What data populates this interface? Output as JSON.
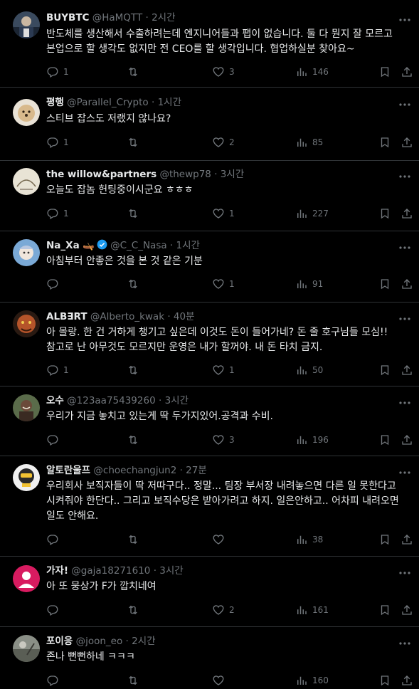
{
  "tweets": [
    {
      "name": "BUYBTC",
      "handle": "@HaMQTT",
      "time": "2시간",
      "text": "반도체를 생산해서 수출하려는데 엔지니어들과 팹이 없습니다. 둘 다 뭔지 잘 모르고 본업으로 할 생각도 없지만 전 CEO를 할 생각입니다. 협업하실분 찾아요~",
      "replies": "1",
      "retweets": "",
      "likes": "3",
      "views": "146"
    },
    {
      "name": "평행",
      "handle": "@Parallel_Crypto",
      "time": "1시간",
      "text": "스티브 잡스도 저랬지 않나요?",
      "replies": "1",
      "retweets": "",
      "likes": "2",
      "views": "85"
    },
    {
      "name": "the willow&partners",
      "handle": "@thewp78",
      "time": "3시간",
      "text": "오늘도 잡놈 헌팅중이시군요 ㅎㅎㅎ",
      "replies": "1",
      "retweets": "",
      "likes": "1",
      "views": "227"
    },
    {
      "name": "Na_Xa",
      "handle": "@C_C_Nasa",
      "time": "1시간",
      "text": "아침부터 안좋은 것을 본 것 같은 기분",
      "replies": "",
      "retweets": "",
      "likes": "1",
      "views": "91"
    },
    {
      "name": "ALB∃RT",
      "handle": "@Alberto_kwak",
      "time": "40분",
      "text": "아 몰랑. 한 건 거하게 챙기고 싶은데 이것도 돈이 들어가네? 돈 줄 호구님들 모심!! 참고로 난 아무것도 모르지만 운영은 내가 할꺼야. 내 돈 타치 금지.",
      "replies": "1",
      "retweets": "",
      "likes": "1",
      "views": "50"
    },
    {
      "name": "오수",
      "handle": "@123aa75439260",
      "time": "3시간",
      "text": "우리가 지금 놓치고 있는게 딱 두가지있어.공격과 수비.",
      "replies": "",
      "retweets": "",
      "likes": "3",
      "views": "196"
    },
    {
      "name": "알토란울프",
      "handle": "@choechangjun2",
      "time": "27분",
      "text": "우리회사 보직자들이 딱 저따구다.. 정말... 팀장 부서장 내려놓으면 다른 일 못한다고 시켜줘야 한단다.. 그리고 보직수당은 받아가려고 하지. 일은안하고.. 어차피 내려오면 일도 안해요.",
      "replies": "",
      "retweets": "",
      "likes": "",
      "views": "38"
    },
    {
      "name": "가자!",
      "handle": "@gaja18271610",
      "time": "3시간",
      "text": "아 또 뭉상가 F가 깝치네여",
      "replies": "",
      "retweets": "",
      "likes": "2",
      "views": "161"
    },
    {
      "name": "포이응",
      "handle": "@joon_eo",
      "time": "2시간",
      "text": "존나 뻔뻔하네 ㅋㅋㅋ",
      "replies": "",
      "retweets": "",
      "likes": "",
      "views": "160"
    }
  ],
  "icons": {
    "reply": "reply-icon",
    "retweet": "retweet-icon",
    "like": "heart-icon",
    "views": "views-icon",
    "bookmark": "bookmark-icon",
    "share": "share-icon",
    "more": "more-icon",
    "verified": "verified-badge-icon"
  },
  "colors": {
    "background": "#000000",
    "text": "#e7e9ea",
    "muted": "#71767b",
    "divider": "#2f3336",
    "verified": "#1d9bf0"
  }
}
